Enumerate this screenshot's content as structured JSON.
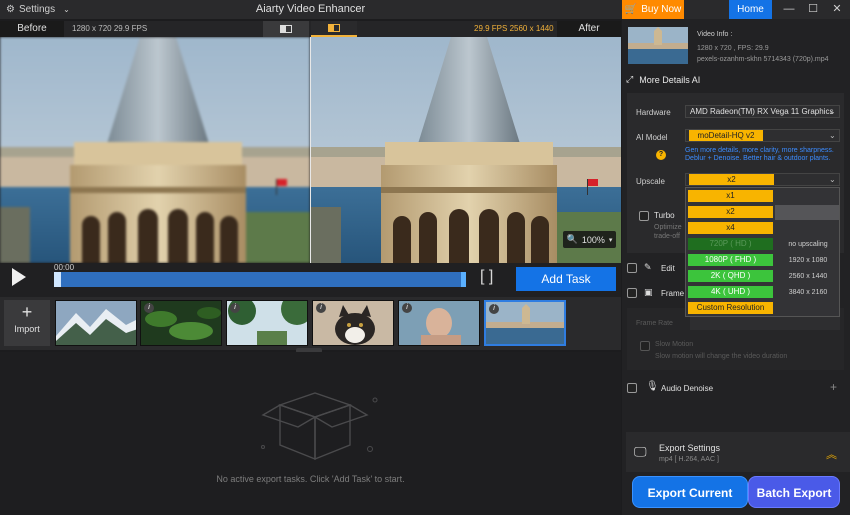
{
  "titlebar": {
    "settings_label": "Settings",
    "app_title": "Aiarty Video Enhancer",
    "buy_now": "Buy Now",
    "home": "Home"
  },
  "preview": {
    "before_label": "Before",
    "after_label": "After",
    "left_info": "1280 x 720  29.9 FPS",
    "right_info": "29.9 FPS  2560 x 1440",
    "zoom": "100%"
  },
  "playback": {
    "time": "00:00",
    "add_task": "Add Task"
  },
  "thumbnails": {
    "import_label": "Import"
  },
  "tasks": {
    "empty_message": "No active export tasks. Click 'Add Task' to start."
  },
  "video_info": {
    "title": "Video Info :",
    "line1": "1280 x 720 ,       FPS: 29.9",
    "line2": "pexels-ozanhm-skhn   5714343 (720p).mp4"
  },
  "details": {
    "section_title": "More Details AI",
    "hardware_label": "Hardware",
    "hardware_value": "AMD Radeon(TM) RX Vega 11 Graphics",
    "ai_model_label": "AI Model",
    "ai_model_value": "moDetail-HQ  v2",
    "model_desc": "Gen more details, more clarity, more sharpness. Deblur + Denoise. Better hair & outdoor plants.",
    "upscale_label": "Upscale",
    "upscale_value": "x2",
    "turbo_label": "Turbo",
    "turbo_desc_1": "Optimize",
    "turbo_desc_2": "trade-off"
  },
  "dropdown": {
    "options": [
      "x1",
      "x2",
      "x4",
      "720P ( HD )",
      "1080P ( FHD )",
      "2K ( QHD )",
      "4K ( UHD )",
      "Custom Resolution"
    ],
    "resolutions": [
      "no upscaling",
      "1920 x 1080",
      "2560 x 1440",
      "3840 x 2160"
    ]
  },
  "sections": {
    "edit": "Edit",
    "frame": "Frame I",
    "frame_rate": "Frame Rate",
    "slow_motion": "Slow Motion",
    "slow_motion_desc": "Slow motion will change the video duration",
    "audio_denoise": "Audio Denoise"
  },
  "export": {
    "settings_title": "Export Settings",
    "settings_desc": "mp4 [ H.264, AAC ]",
    "export_current": "Export Current",
    "batch_export": "Batch Export"
  },
  "colors": {
    "accent_blue": "#1473e6",
    "accent_orange": "#ff8a00",
    "accent_yellow": "#f8b400",
    "accent_green": "#3cc43c"
  }
}
